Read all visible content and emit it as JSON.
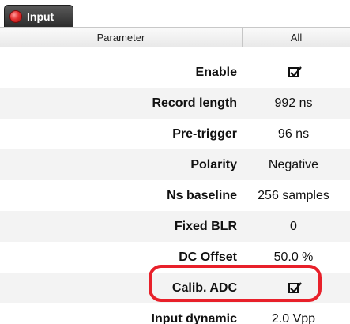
{
  "tab": {
    "label": "Input",
    "status_color": "#e53030"
  },
  "table": {
    "headers": [
      "Parameter",
      "All"
    ],
    "rows": [
      {
        "label": "Enable",
        "value": "",
        "checked": true
      },
      {
        "label": "Record length",
        "value": "992 ns"
      },
      {
        "label": "Pre-trigger",
        "value": "96 ns"
      },
      {
        "label": "Polarity",
        "value": "Negative"
      },
      {
        "label": "Ns baseline",
        "value": "256 samples"
      },
      {
        "label": "Fixed BLR",
        "value": "0"
      },
      {
        "label": "DC Offset",
        "value": "50.0 %"
      },
      {
        "label": "Calib. ADC",
        "value": "",
        "checked": true
      },
      {
        "label": "Input dynamic",
        "value": "2.0 Vpp"
      }
    ]
  },
  "annotation": {
    "target": "Calib. ADC",
    "color": "#e8202a"
  }
}
